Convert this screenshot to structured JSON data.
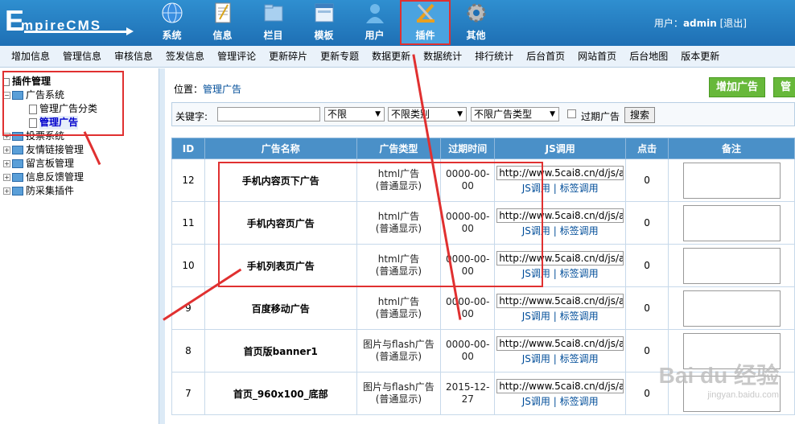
{
  "brand": {
    "first": "E",
    "rest": "mpireCMS"
  },
  "topnav": [
    {
      "label": "系统",
      "icon": "globe-icon"
    },
    {
      "label": "信息",
      "icon": "document-icon"
    },
    {
      "label": "栏目",
      "icon": "folder-icon"
    },
    {
      "label": "模板",
      "icon": "template-icon"
    },
    {
      "label": "用户",
      "icon": "user-icon"
    },
    {
      "label": "插件",
      "icon": "plugin-tools-icon",
      "active": true
    },
    {
      "label": "其他",
      "icon": "gear-icon"
    }
  ],
  "user": {
    "prefix": "用户：",
    "name": "admin",
    "logout": "[退出]"
  },
  "menubar": [
    "增加信息",
    "管理信息",
    "审核信息",
    "签发信息",
    "管理评论",
    "更新碎片",
    "更新专题",
    "数据更新",
    "数据统计",
    "排行统计",
    "后台首页",
    "网站首页",
    "后台地图",
    "版本更新"
  ],
  "tree": {
    "root": "插件管理",
    "ad_system": "广告系统",
    "ad_category": "管理广告分类",
    "ad_manage": "管理广告",
    "others": [
      "投票系统",
      "友情链接管理",
      "留言板管理",
      "信息反馈管理",
      "防采集插件"
    ]
  },
  "location": {
    "prefix": "位置：",
    "link": "管理广告"
  },
  "buttons": {
    "add": "增加广告",
    "manage": "管理"
  },
  "search": {
    "keyword_label": "关键字:",
    "keyword_value": "",
    "scope": "不限",
    "category": "不限类别",
    "ad_type": "不限广告类型",
    "expired_label": "过期广告",
    "search_btn": "搜索"
  },
  "table": {
    "headers": [
      "ID",
      "广告名称",
      "广告类型",
      "过期时间",
      "JS调用",
      "点击",
      "备注"
    ],
    "rows": [
      {
        "id": "12",
        "name": "手机内容页下广告",
        "type1": "html广告",
        "type2": "(普通显示)",
        "time1": "0000-00-",
        "time2": "00",
        "js": "http://www.5cai8.cn/d/js/a",
        "links": "JS调用 | 标签调用",
        "clicks": "0"
      },
      {
        "id": "11",
        "name": "手机内容页广告",
        "type1": "html广告",
        "type2": "(普通显示)",
        "time1": "0000-00-",
        "time2": "00",
        "js": "http://www.5cai8.cn/d/js/a",
        "links": "JS调用 | 标签调用",
        "clicks": "0"
      },
      {
        "id": "10",
        "name": "手机列表页广告",
        "type1": "html广告",
        "type2": "(普通显示)",
        "time1": "0000-00-",
        "time2": "00",
        "js": "http://www.5cai8.cn/d/js/a",
        "links": "JS调用 | 标签调用",
        "clicks": "0"
      },
      {
        "id": "9",
        "name": "百度移动广告",
        "type1": "html广告",
        "type2": "(普通显示)",
        "time1": "0000-00-",
        "time2": "00",
        "js": "http://www.5cai8.cn/d/js/a",
        "links": "JS调用 | 标签调用",
        "clicks": "0"
      },
      {
        "id": "8",
        "name": "首页版banner1",
        "type1": "图片与flash广告",
        "type2": "(普通显示)",
        "time1": "0000-00-",
        "time2": "00",
        "js": "http://www.5cai8.cn/d/js/a",
        "links": "JS调用 | 标签调用",
        "clicks": "0"
      },
      {
        "id": "7",
        "name": "首页_960x100_底部",
        "type1": "图片与flash广告",
        "type2": "(普通显示)",
        "time1": "2015-12-",
        "time2": "27",
        "js": "http://www.5cai8.cn/d/js/a",
        "links": "JS调用 | 标签调用",
        "clicks": "0"
      }
    ]
  },
  "watermark": {
    "text": "Bai du 经验",
    "sub": "jingyan.baidu.com"
  },
  "colors": {
    "header": "#1e6fb4",
    "highlight": "#e03030",
    "table_header": "#4a90c8",
    "button": "#67b83a"
  }
}
